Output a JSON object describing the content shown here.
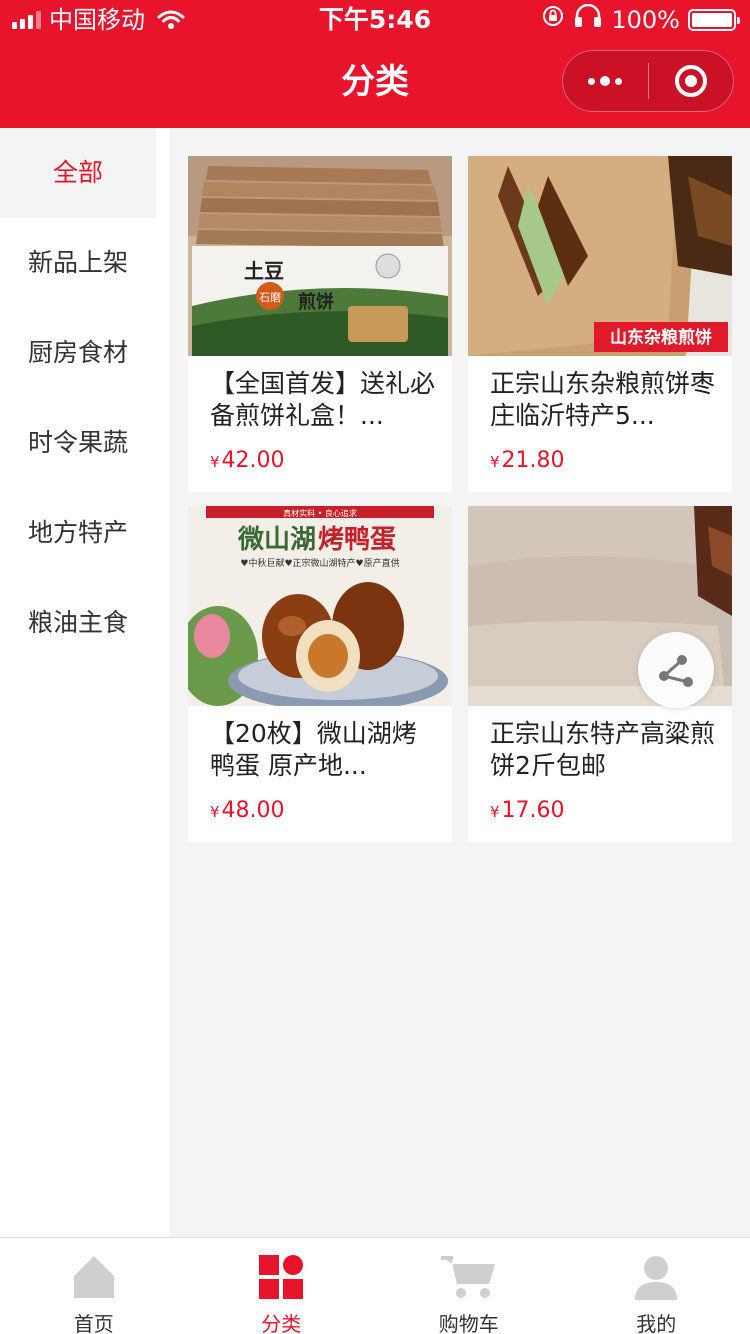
{
  "status_bar": {
    "carrier": "中国移动",
    "time": "下午5:46",
    "battery": "100%"
  },
  "nav": {
    "title": "分类"
  },
  "sidebar": {
    "items": [
      {
        "label": "全部",
        "active": true
      },
      {
        "label": "新品上架",
        "active": false
      },
      {
        "label": "厨房食材",
        "active": false
      },
      {
        "label": "时令果蔬",
        "active": false
      },
      {
        "label": "地方特产",
        "active": false
      },
      {
        "label": "粮油主食",
        "active": false
      }
    ]
  },
  "products": [
    {
      "title": "【全国首发】送礼必备煎饼礼盒！...",
      "currency": "¥",
      "price": "42.00",
      "image_text": {
        "left": "土豆",
        "badge": "石磨",
        "right": "煎饼"
      }
    },
    {
      "title": "正宗山东杂粮煎饼枣庄临沂特产5...",
      "currency": "¥",
      "price": "21.80",
      "image_text": {
        "banner": "山东杂粮煎饼"
      }
    },
    {
      "title": "【20枚】微山湖烤鸭蛋 原产地...",
      "currency": "¥",
      "price": "48.00",
      "image_text": {
        "top": "真材实料 • 良心追求",
        "main_a": "微山湖",
        "main_b": "烤鸭蛋",
        "sub": "♥中秋巨献♥正宗微山湖特产♥原产直供"
      }
    },
    {
      "title": "正宗山东特产高粱煎饼2斤包邮",
      "currency": "¥",
      "price": "17.60"
    }
  ],
  "tabbar": {
    "items": [
      {
        "label": "首页",
        "icon": "home-icon",
        "active": false
      },
      {
        "label": "分类",
        "icon": "category-icon",
        "active": true
      },
      {
        "label": "购物车",
        "icon": "cart-icon",
        "active": false
      },
      {
        "label": "我的",
        "icon": "user-icon",
        "active": false
      }
    ]
  },
  "colors": {
    "brand": "#e8142b",
    "background": "#f4f4f4"
  }
}
